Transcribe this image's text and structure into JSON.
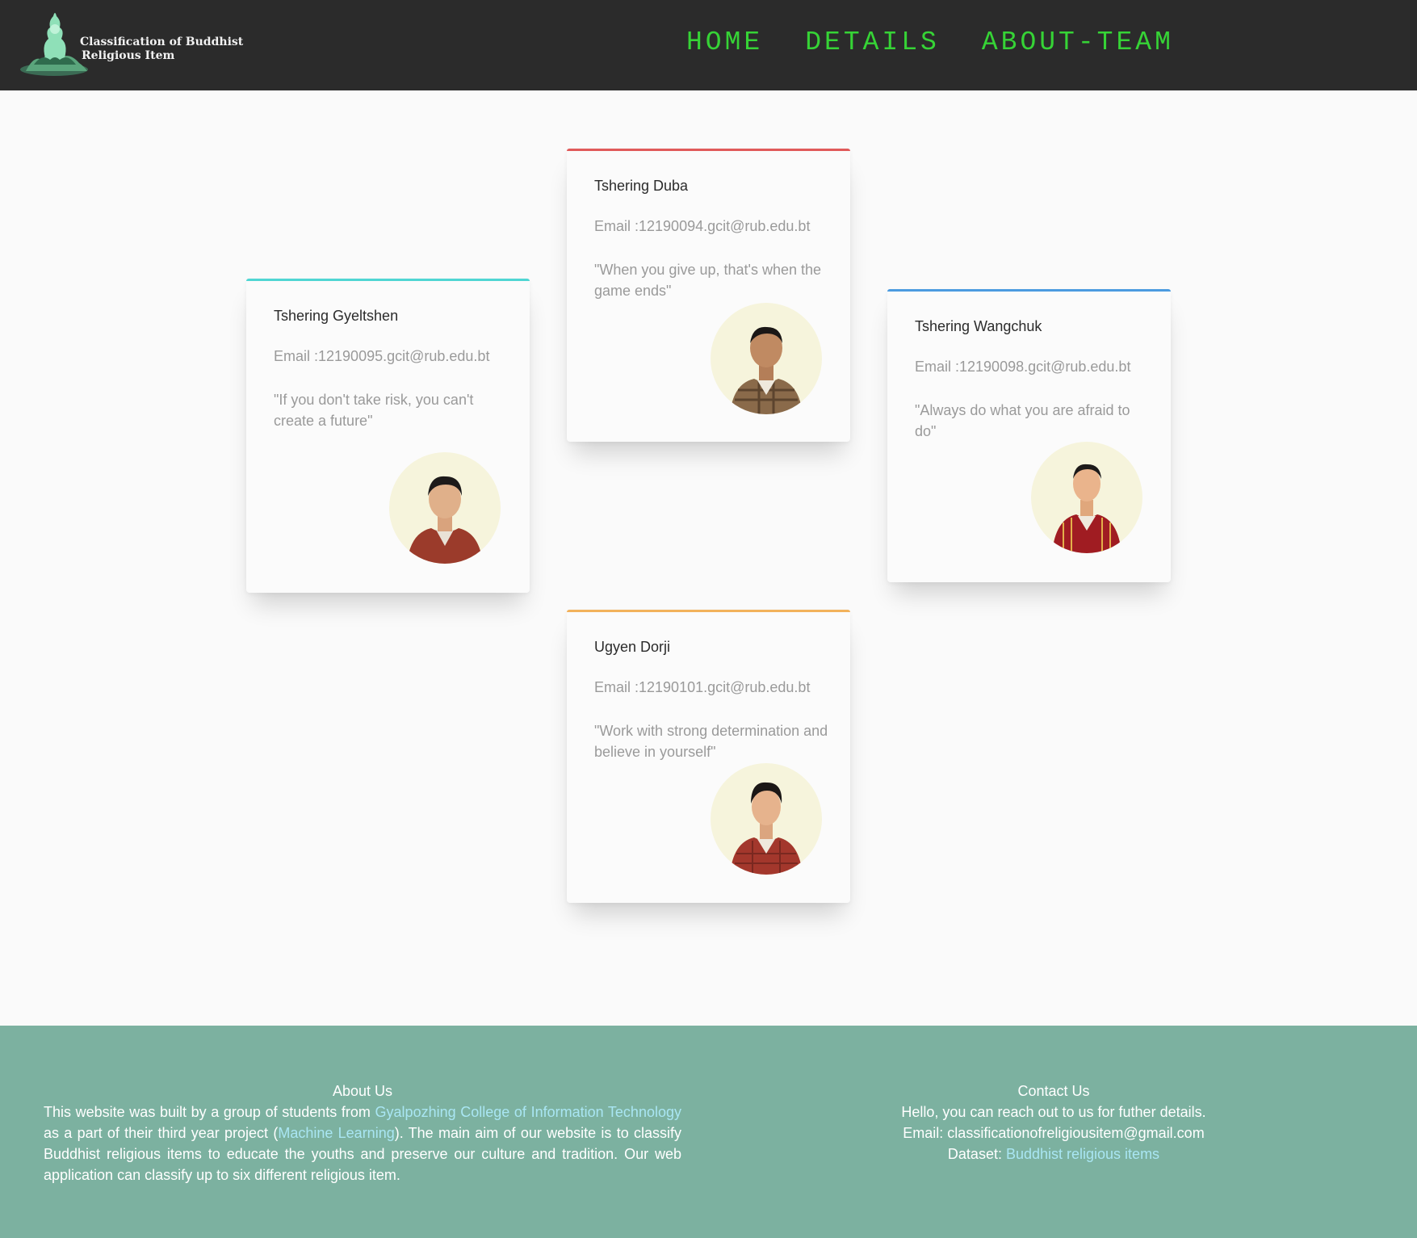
{
  "header": {
    "logo_line1": "Classification of Buddhist",
    "logo_line2": "Religious Item",
    "nav": [
      "HOME",
      "DETAILS",
      "ABOUT-TEAM"
    ],
    "nav_color": "#36d336",
    "background": "#2b2b2b"
  },
  "team": [
    {
      "name": "Tshering Gyeltshen",
      "email": "Email :12190095.gcit@rub.edu.bt",
      "quote": "\"If you don't take risk, you can't create a future\"",
      "accent": "#4fd6d3",
      "avatar": "portrait-photo"
    },
    {
      "name": "Tshering Duba",
      "email": "Email :12190094.gcit@rub.edu.bt",
      "quote": "\"When you give up, that's when the game ends\"",
      "accent": "#e05a5a",
      "avatar": "portrait-photo"
    },
    {
      "name": "Tshering Wangchuk",
      "email": "Email :12190098.gcit@rub.edu.bt",
      "quote": "\"Always do what you are afraid to do\"",
      "accent": "#4b9be0",
      "avatar": "portrait-photo"
    },
    {
      "name": "Ugyen Dorji",
      "email": "Email :12190101.gcit@rub.edu.bt",
      "quote": "\"Work with strong determination and believe in yourself\"",
      "accent": "#f2b25c",
      "avatar": "portrait-photo"
    }
  ],
  "footer": {
    "background": "#7cb1a0",
    "link_color": "#a9e6f3",
    "about": {
      "title": "About Us",
      "text1": "This website was built by a group of students from ",
      "link1": "Gyalpozhing College of Information Technology",
      "text2": " as a part of their third year project (",
      "link2": "Machine Learning",
      "text3": "). The main aim of our website is to classify Buddhist religious items to educate the youths and preserve our culture and tradition. Our web application can classify up to six different religious item."
    },
    "contact": {
      "title": "Contact Us",
      "line1": "Hello, you can reach out to us for futher details.",
      "line2": "Email: classificationofreligiousitem@gmail.com",
      "dataset_label": "Dataset: ",
      "dataset_link": "Buddhist religious items"
    }
  }
}
